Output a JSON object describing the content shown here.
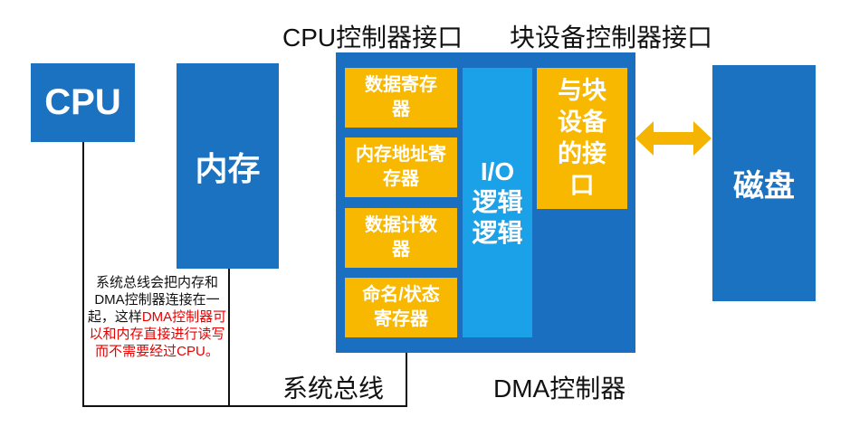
{
  "headers": {
    "cpu_interface": "CPU控制器接口",
    "block_interface": "块设备控制器接口"
  },
  "boxes": {
    "cpu": "CPU",
    "memory": "内存",
    "disk": "磁盘"
  },
  "dma": {
    "registers": [
      "数据寄存器",
      "内存地址寄存器",
      "数据计数器",
      "命名/状态寄存器"
    ],
    "io_logic": "I/O逻辑逻辑",
    "block_device_interface": "与块设备的接口",
    "label": "DMA控制器"
  },
  "bus_label": "系统总线",
  "note": {
    "black": "系统总线会把内存和DMA控制器连接在一起，这样",
    "red": "DMA控制器可以和内存直接进行读写而不需要经过CPU。"
  },
  "colors": {
    "blue": "#1a72c0",
    "dma_blue": "#1a6fc0",
    "cyan": "#1ba1e8",
    "orange": "#f8b800",
    "arrow": "#f5b400",
    "note_red": "#e60000"
  }
}
